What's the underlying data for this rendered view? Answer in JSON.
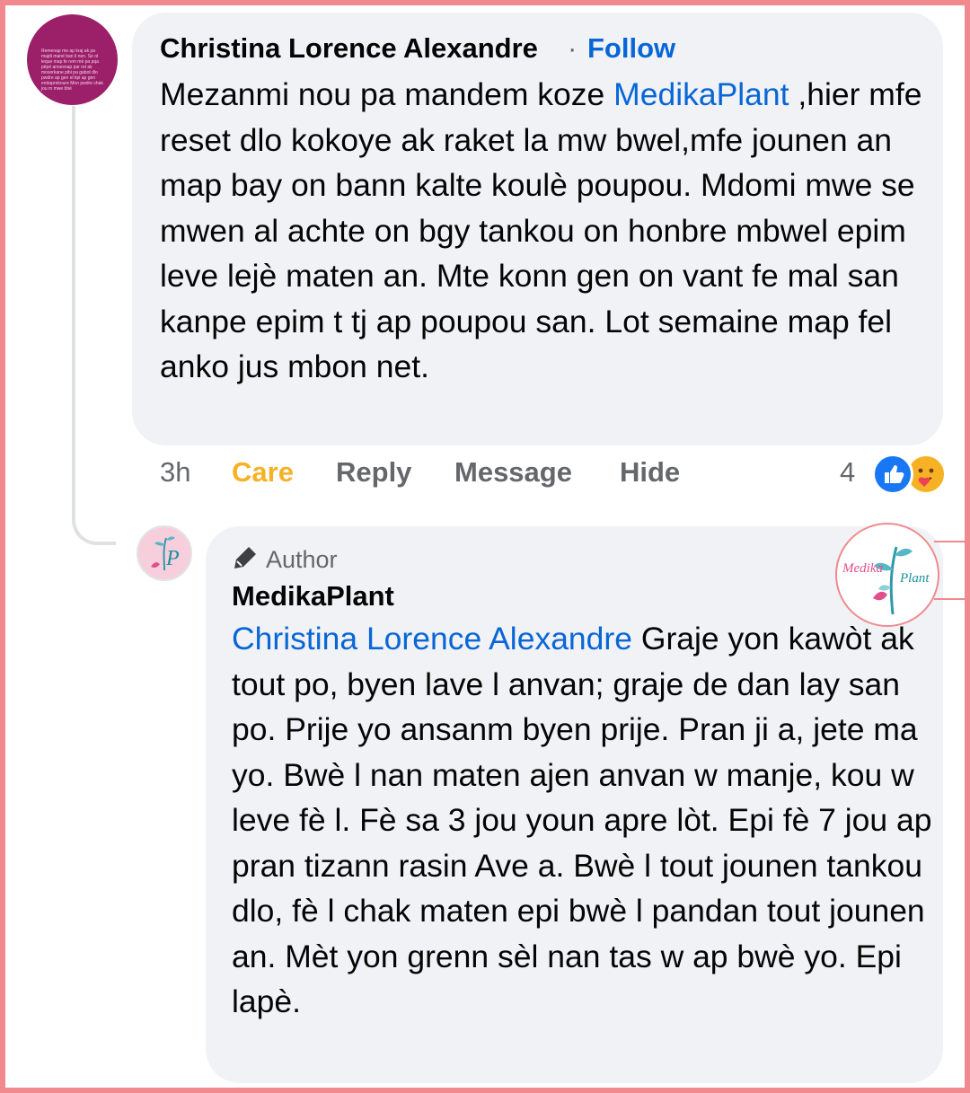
{
  "comment": {
    "author_name": "Christina Lorence Alexandre",
    "separator": "·",
    "follow_label": "Follow",
    "text_before_mention": "Mezanmi nou pa mandem koze ",
    "mention": "MedikaPlant",
    "text_after_mention": " ,hier mfe reset dlo kokoye ak raket la mw bwel,mfe jounen an map bay on bann kalte koulè poupou. Mdomi mwe se mwen al achte on bgy tankou on honbre mbwel epim leve lejè maten an. Mte konn gen on vant fe mal san kanpe epim t tj ap poupou san. Lot semaine map fel anko jus mbon net.",
    "avatar_text": "Remenap me ap kraj ak pa majdi mané ban li nen. Se ol leque map fe rem mè pa pqa pèpé ansesnap par ret ak mosorkane pibi pa gabot dlo pwdre ap gen el kpi ap gen endaprekoure Mon pwdre chak jou m mwe bbé"
  },
  "actions": {
    "time": "3h",
    "reaction_label": "Care",
    "reply_label": "Reply",
    "message_label": "Message",
    "hide_label": "Hide",
    "reaction_count": "4"
  },
  "reply": {
    "badge_label": "Author",
    "author_name": "MedikaPlant",
    "mention": "Christina Lorence Alexandre",
    "text": " Graje yon kawòt ak tout po, byen lave l anvan; graje de dan lay san po. Prije yo ansanm byen prije. Pran ji a, jete ma yo. Bwè l nan maten ajen anvan w manje, kou w leve fè l. Fè sa 3 jou youn apre lòt. Epi fè 7 jou ap pran tizann rasin Ave a. Bwè l tout jounen tankou dlo, fè l chak maten epi bwè l pandan tout jounen an. Mèt yon grenn sèl nan tas w ap bwè yo. Epi lapè."
  },
  "logo": {
    "text_medika": "Medika",
    "text_plant": "Plant"
  },
  "colors": {
    "link": "#0866d6",
    "care": "#f7b125",
    "frame": "#f08a8f",
    "bubble": "#f0f2f5"
  }
}
